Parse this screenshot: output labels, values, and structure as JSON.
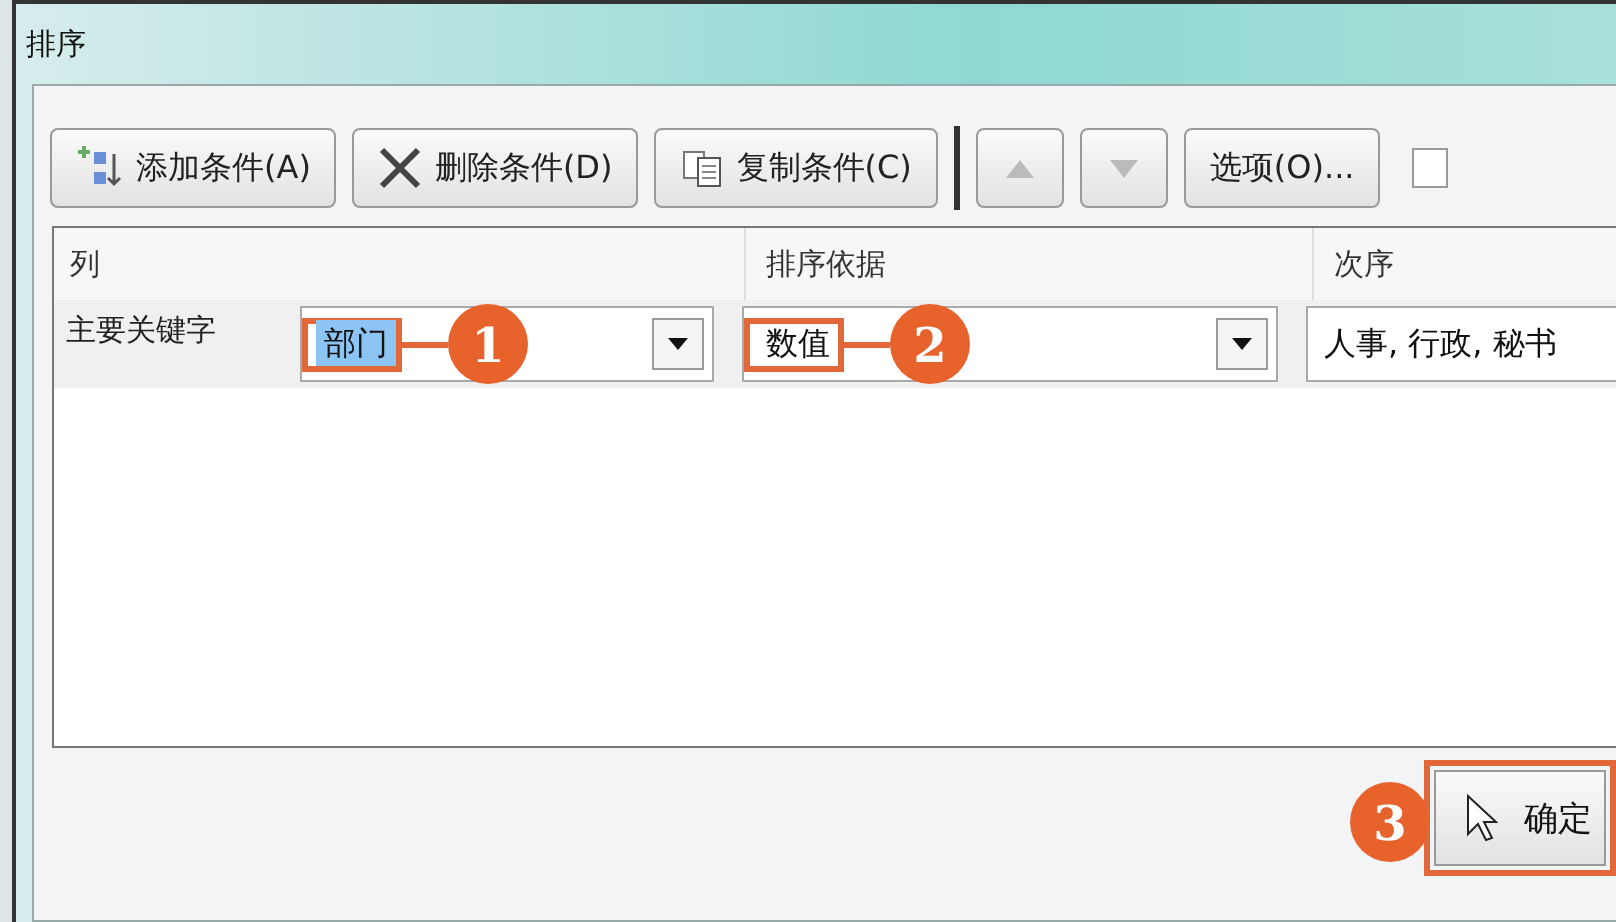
{
  "window": {
    "title": "排序"
  },
  "toolbar": [
    {
      "kind": "add",
      "label": "添加条件(A)"
    },
    {
      "kind": "delete",
      "label": "删除条件(D)"
    },
    {
      "kind": "copy",
      "label": "复制条件(C)"
    },
    {
      "kind": "up",
      "disabled": true
    },
    {
      "kind": "down",
      "disabled": true
    },
    {
      "kind": "options",
      "label": "选项(O)..."
    }
  ],
  "columns": [
    "列",
    "排序依据",
    "次序"
  ],
  "rows": [
    {
      "label": "主要关键字",
      "column": {
        "value": "部门",
        "selected": true,
        "callout": "1"
      },
      "sort_on": {
        "value": "数值",
        "callout": "2"
      },
      "order": {
        "value": "人事, 行政, 秘书"
      }
    }
  ],
  "ok_button": {
    "label": "确定",
    "callout": "3"
  }
}
